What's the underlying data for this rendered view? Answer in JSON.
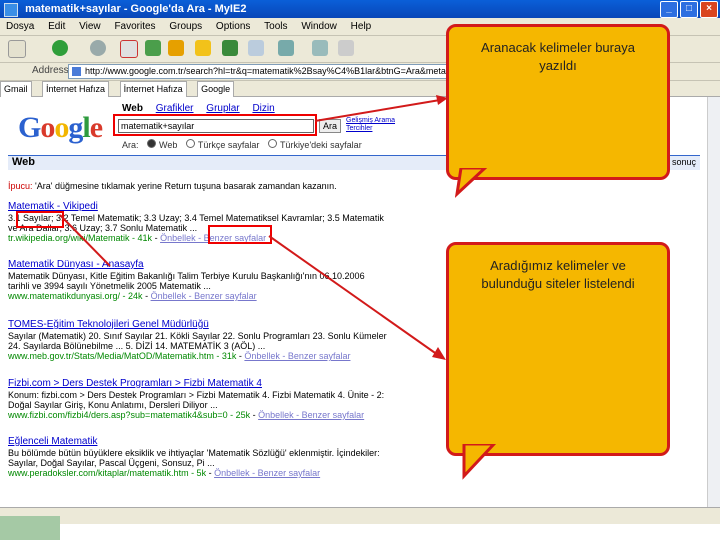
{
  "window": {
    "title": "matematik+sayılar - Google'da Ara - MyIE2",
    "buttons": [
      "_",
      "□",
      "×"
    ]
  },
  "menubar": {
    "items": [
      "Dosya",
      "Edit",
      "View",
      "Favorites",
      "Groups",
      "Options",
      "Tools",
      "Window",
      "Help"
    ]
  },
  "address": {
    "label": "Address",
    "url": "http://www.google.com.tr/search?hl=tr&q=matematik%2Bsay%C4%B1lar&btnG=Ara&meta="
  },
  "links_bar": {
    "items": [
      "Gmail",
      "İnternet Hafıza",
      "İnternet Hafıza",
      "Google"
    ]
  },
  "google": {
    "logo": "Google",
    "tabs": [
      "Web",
      "Grafikler",
      "Gruplar",
      "Dizin"
    ],
    "query": "matematik+sayılar",
    "search_button": "Ara",
    "adv_links": [
      "Gelişmiş Arama",
      "Tercihler"
    ],
    "radio_options": [
      "Web",
      "Türkçe sayfalar",
      "Türkiye'deki sayfalar"
    ],
    "radio_prefix": "Ara:",
    "result_bar_title": "Web",
    "result_bar_stats": "matematik+sayılar için yaklaşık 1 sonuç",
    "tip_label": "İpucu:",
    "tip_text": " 'Ara' düğmesine tıklamak yerine Return tuşuna basarak zamandan kazanın."
  },
  "results": [
    {
      "title": "Matematik - Vikipedi",
      "snippet": "3.1 Sayılar; 3.2 Temel Matematik; 3.3 Uzay; 3.4 Temel Matematiksel Kavramlar; 3.5 Matematik ve Ara Dallar; 3.6 Uzay; 3.7 Sonlu Matematik ...",
      "url": "tr.wikipedia.org/wiki/Matematik - 41k",
      "cache": "Önbellek - Benzer sayfalar"
    },
    {
      "title": "Matematik Dünyası - Anasayfa",
      "snippet": "Matematik Dünyası, Kitle Eğitim Bakanlığı Talim Terbiye Kurulu Başkanlığı'nın 06.10.2006 tarihli ve 3994 sayılı Yönetmelik 2005 Matematik ...",
      "url": "www.matematikdunyasi.org/ - 24k",
      "cache": "Önbellek - Benzer sayfalar"
    },
    {
      "title": "TOMES-Eğitim Teknolojileri Genel Müdürlüğü",
      "snippet": "Sayılar (Matematik) 20. Sınıf Sayılar 21. Kökli Sayılar 22. Sonlu Programları 23. Sonlu Kümeler 24. Sayılarda Bölünebilme ... 5. DİZİ 14. MATEMATİK 3 (AÖL) ...",
      "url": "www.meb.gov.tr/Stats/Media/MatOD/Matematik.htm - 31k",
      "cache": "Önbellek - Benzer sayfalar"
    },
    {
      "title": "Fizbi.com > Ders Destek Programları > Fizbi Matematik 4",
      "snippet": "Konum: fizbi.com > Ders Destek Programları > Fizbi Matematik 4. Fizbi Matematik 4. Ünite - 2: Doğal Sayılar Giriş, Konu Anlatımı, Dersleri Diliyor ...",
      "url": "www.fizbi.com/fizbi4/ders.asp?sub=matematik4&sub=0 - 25k",
      "cache": "Önbellek - Benzer sayfalar"
    },
    {
      "title": "Eğlenceli Matematik",
      "snippet": "Bu bölümde bütün büyüklere eksiklik ve ihtiyaçlar 'Matematik Sözlüğü' eklenmiştir. İçindekiler: Sayılar, Doğal Sayılar, Pascal Üçgeni, Sonsuz, Pi ...",
      "url": "www.peradoksler.com/kitaplar/matematik.htm - 5k",
      "cache": "Önbellek - Benzer sayfalar"
    }
  ],
  "callouts": {
    "top": "Aranacak kelimeler buraya yazıldı",
    "middle": "Aradığımız kelimeler ve bulunduğu siteler listelendi"
  }
}
